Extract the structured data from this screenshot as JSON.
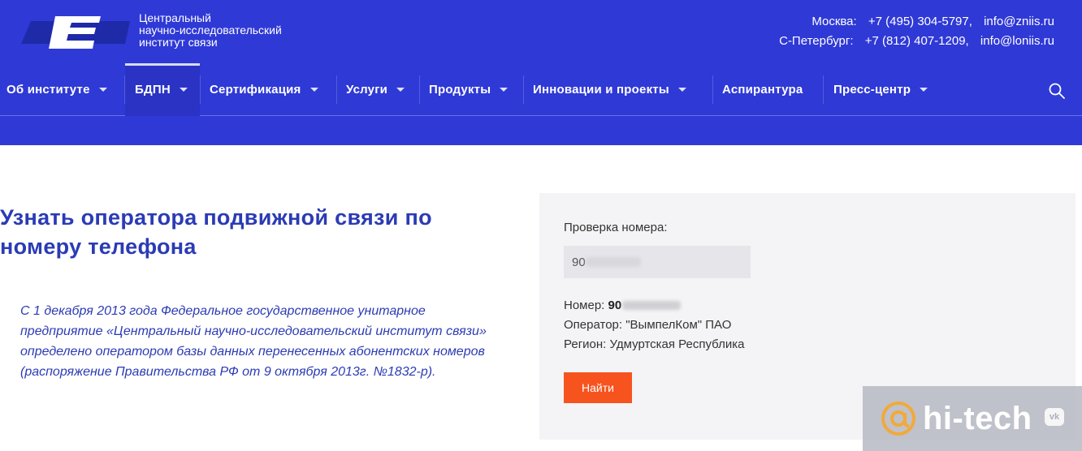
{
  "header": {
    "logo_icon": "zniis-logo-icon",
    "logo_lines": [
      "Центральный",
      "научно-исследовательский",
      "институт связи"
    ],
    "contacts": [
      {
        "city": "Москва:",
        "phone": "+7 (495) 304-5797,",
        "email": "info@zniis.ru"
      },
      {
        "city": "С-Петербург:",
        "phone": "+7 (812) 407-1209,",
        "email": "info@loniis.ru"
      }
    ]
  },
  "nav": {
    "items": [
      {
        "label": "Об институте",
        "has_dropdown": true
      },
      {
        "label": "БДПН",
        "has_dropdown": true,
        "active": true
      },
      {
        "label": "Сертификация",
        "has_dropdown": true
      },
      {
        "label": "Услуги",
        "has_dropdown": true
      },
      {
        "label": "Продукты",
        "has_dropdown": true
      },
      {
        "label": "Инновации и проекты",
        "has_dropdown": true
      },
      {
        "label": "Аспирантура",
        "has_dropdown": false
      },
      {
        "label": "Пресс-центр",
        "has_dropdown": true
      }
    ],
    "search_icon": "search-icon"
  },
  "main": {
    "title_line1": "Узнать оператора подвижной связи по",
    "title_line2": "номеру телефона",
    "lead_lines": [
      "С 1 декабря 2013 года Федеральное государственное унитарное",
      "предприятие «Центральный научно-исследовательский институт связи»",
      "определено оператором базы данных перенесенных абонентских номеров",
      "(распоряжение Правительства РФ от 9 октября 2013г. №1832-р)."
    ]
  },
  "checker": {
    "label": "Проверка номера:",
    "input_value": "90",
    "number_label": "Номер:",
    "number_value": "90",
    "operator_label": "Оператор:",
    "operator_value": "\"ВымпелКом\" ПАО",
    "region_label": "Регион:",
    "region_value": "Удмуртская Республика",
    "button_label": "Найти"
  },
  "watermark": {
    "text": "hi-tech",
    "vk_label": "vk"
  },
  "colors": {
    "header_bg": "#2f39d6",
    "title": "#2b3bb5",
    "button": "#f7531f",
    "panel_bg": "#f4f4f6"
  }
}
